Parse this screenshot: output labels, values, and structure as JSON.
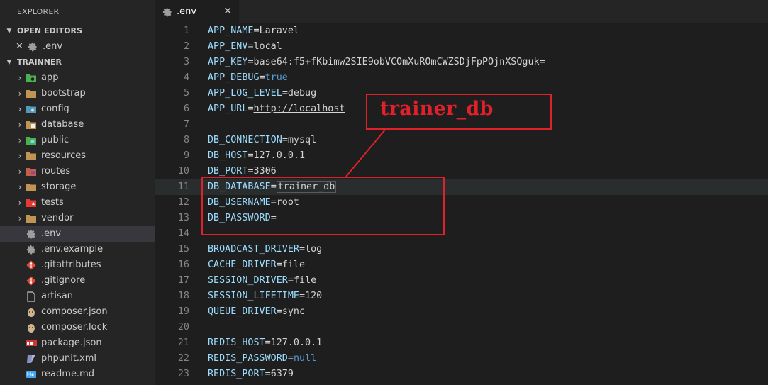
{
  "sidebar": {
    "title": "EXPLORER",
    "open_editors": {
      "header": "OPEN EDITORS",
      "items": [
        {
          "label": ".env",
          "icon": "gear-icon"
        }
      ]
    },
    "project": {
      "header": "TRAINNER",
      "folders": [
        {
          "label": "app",
          "icon": "folder-app-icon",
          "color": "#4caf50"
        },
        {
          "label": "bootstrap",
          "icon": "folder-icon",
          "color": "#c09553"
        },
        {
          "label": "config",
          "icon": "folder-config-icon",
          "color": "#519aba"
        },
        {
          "label": "database",
          "icon": "folder-database-icon",
          "color": "#c09553"
        },
        {
          "label": "public",
          "icon": "folder-public-icon",
          "color": "#4caf50"
        },
        {
          "label": "resources",
          "icon": "folder-icon",
          "color": "#c09553"
        },
        {
          "label": "routes",
          "icon": "folder-routes-icon",
          "color": "#c0604a"
        },
        {
          "label": "storage",
          "icon": "folder-icon",
          "color": "#c09553"
        },
        {
          "label": "tests",
          "icon": "folder-tests-icon",
          "color": "#e53935"
        },
        {
          "label": "vendor",
          "icon": "folder-icon",
          "color": "#c09553"
        }
      ],
      "files": [
        {
          "label": ".env",
          "icon": "gear-icon",
          "active": true
        },
        {
          "label": ".env.example",
          "icon": "gear-icon"
        },
        {
          "label": ".gitattributes",
          "icon": "git-icon"
        },
        {
          "label": ".gitignore",
          "icon": "git-icon"
        },
        {
          "label": "artisan",
          "icon": "file-icon"
        },
        {
          "label": "composer.json",
          "icon": "composer-icon"
        },
        {
          "label": "composer.lock",
          "icon": "composer-icon"
        },
        {
          "label": "package.json",
          "icon": "npm-icon"
        },
        {
          "label": "phpunit.xml",
          "icon": "phpunit-icon"
        },
        {
          "label": "readme.md",
          "icon": "markdown-icon"
        }
      ]
    }
  },
  "tab": {
    "label": ".env",
    "close": "✕"
  },
  "editor": {
    "lines": [
      {
        "n": "1",
        "key": "APP_NAME",
        "eq": "=",
        "val": "Laravel",
        "type": "v"
      },
      {
        "n": "2",
        "key": "APP_ENV",
        "eq": "=",
        "val": "local",
        "type": "v"
      },
      {
        "n": "3",
        "key": "APP_KEY",
        "eq": "=",
        "val": "base64:f5+fKbimw2SIE9obVCOmXuROmCWZSDjFpPOjnXSQguk=",
        "type": "v"
      },
      {
        "n": "4",
        "key": "APP_DEBUG",
        "eq": "=",
        "val": "true",
        "type": "kw"
      },
      {
        "n": "5",
        "key": "APP_LOG_LEVEL",
        "eq": "=",
        "val": "debug",
        "type": "v"
      },
      {
        "n": "6",
        "key": "APP_URL",
        "eq": "=",
        "val": "http://localhost",
        "type": "url"
      },
      {
        "n": "7",
        "key": "",
        "eq": "",
        "val": "",
        "type": "v"
      },
      {
        "n": "8",
        "key": "DB_CONNECTION",
        "eq": "=",
        "val": "mysql",
        "type": "v"
      },
      {
        "n": "9",
        "key": "DB_HOST",
        "eq": "=",
        "val": "127.0.0.1",
        "type": "v"
      },
      {
        "n": "10",
        "key": "DB_PORT",
        "eq": "=",
        "val": "3306",
        "type": "v"
      },
      {
        "n": "11",
        "key": "DB_DATABASE",
        "eq": "=",
        "val": "trainer_db",
        "type": "sel"
      },
      {
        "n": "12",
        "key": "DB_USERNAME",
        "eq": "=",
        "val": "root",
        "type": "v"
      },
      {
        "n": "13",
        "key": "DB_PASSWORD",
        "eq": "=",
        "val": "",
        "type": "v"
      },
      {
        "n": "14",
        "key": "",
        "eq": "",
        "val": "",
        "type": "v"
      },
      {
        "n": "15",
        "key": "BROADCAST_DRIVER",
        "eq": "=",
        "val": "log",
        "type": "v"
      },
      {
        "n": "16",
        "key": "CACHE_DRIVER",
        "eq": "=",
        "val": "file",
        "type": "v"
      },
      {
        "n": "17",
        "key": "SESSION_DRIVER",
        "eq": "=",
        "val": "file",
        "type": "v"
      },
      {
        "n": "18",
        "key": "SESSION_LIFETIME",
        "eq": "=",
        "val": "120",
        "type": "v"
      },
      {
        "n": "19",
        "key": "QUEUE_DRIVER",
        "eq": "=",
        "val": "sync",
        "type": "v"
      },
      {
        "n": "20",
        "key": "",
        "eq": "",
        "val": "",
        "type": "v"
      },
      {
        "n": "21",
        "key": "REDIS_HOST",
        "eq": "=",
        "val": "127.0.0.1",
        "type": "v"
      },
      {
        "n": "22",
        "key": "REDIS_PASSWORD",
        "eq": "=",
        "val": "null",
        "type": "kw"
      },
      {
        "n": "23",
        "key": "REDIS_PORT",
        "eq": "=",
        "val": "6379",
        "type": "v"
      }
    ]
  },
  "annotation": {
    "label": "trainer_db",
    "color": "#e0202a"
  }
}
